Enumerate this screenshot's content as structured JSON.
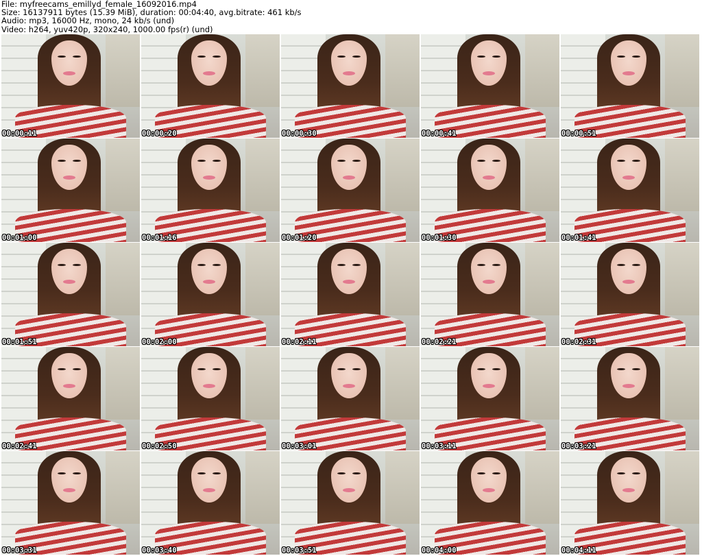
{
  "header": {
    "file_line": "File: myfreecams_emillyd_female_16092016.mp4",
    "size_line": "Size: 16137911 bytes (15.39 MiB), duration: 00:04:40, avg.bitrate: 461 kb/s",
    "audio_line": "Audio: mp3, 16000 Hz, mono, 24 kb/s (und)",
    "video_line": "Video: h264, yuv420p, 320x240, 1000.00 fps(r) (und)"
  },
  "thumbnails": [
    {
      "timestamp": "00:00:11"
    },
    {
      "timestamp": "00:00:20"
    },
    {
      "timestamp": "00:00:30"
    },
    {
      "timestamp": "00:00:41"
    },
    {
      "timestamp": "00:00:51"
    },
    {
      "timestamp": "00:01:00"
    },
    {
      "timestamp": "00:01:16"
    },
    {
      "timestamp": "00:01:20"
    },
    {
      "timestamp": "00:01:30"
    },
    {
      "timestamp": "00:01:41"
    },
    {
      "timestamp": "00:01:51"
    },
    {
      "timestamp": "00:02:00"
    },
    {
      "timestamp": "00:02:11"
    },
    {
      "timestamp": "00:02:21"
    },
    {
      "timestamp": "00:02:31"
    },
    {
      "timestamp": "00:02:41"
    },
    {
      "timestamp": "00:02:50"
    },
    {
      "timestamp": "00:03:01"
    },
    {
      "timestamp": "00:03:11"
    },
    {
      "timestamp": "00:03:21"
    },
    {
      "timestamp": "00:03:31"
    },
    {
      "timestamp": "00:03:40"
    },
    {
      "timestamp": "00:03:51"
    },
    {
      "timestamp": "00:04:00"
    },
    {
      "timestamp": "00:04:11"
    }
  ]
}
